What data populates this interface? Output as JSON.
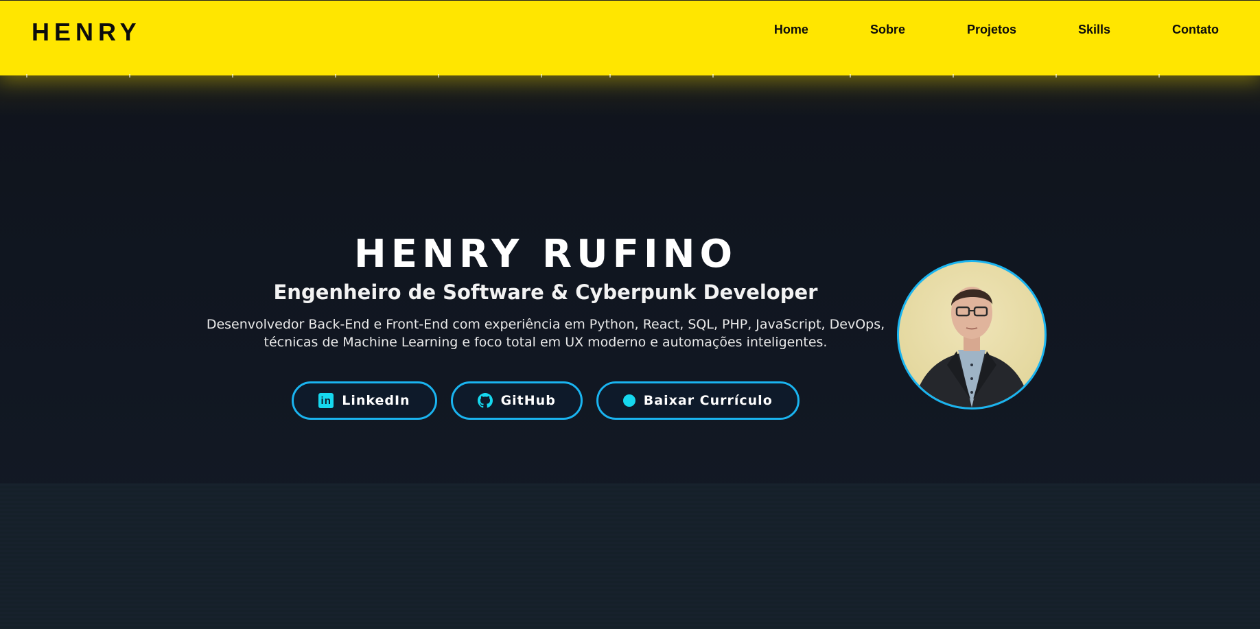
{
  "header": {
    "brand": "HENRY",
    "nav": [
      {
        "label": "Home"
      },
      {
        "label": "Sobre"
      },
      {
        "label": "Projetos"
      },
      {
        "label": "Skills"
      },
      {
        "label": "Contato"
      }
    ],
    "background_color": "#ffe600"
  },
  "hero": {
    "name": "HENRY RUFINO",
    "role": "Engenheiro de Software & Cyberpunk Developer",
    "description_line1": "Desenvolvedor Back-End e Front-End com experiência em Python, React, SQL, PHP, JavaScript, DevOps,",
    "description_line2": "técnicas de Machine Learning e foco total em UX moderno e automações inteligentes.",
    "buttons": [
      {
        "label": "LinkedIn",
        "icon": "linkedin-icon"
      },
      {
        "label": "GitHub",
        "icon": "github-icon"
      },
      {
        "label": "Baixar Currículo",
        "icon": "dot-icon"
      }
    ],
    "accent_color": "#1ab4f0",
    "avatar": "profile-photo"
  }
}
